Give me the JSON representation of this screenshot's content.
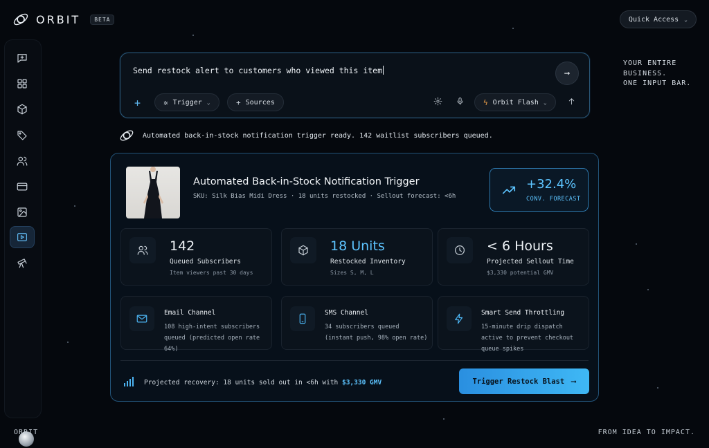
{
  "brand": {
    "name": "ORBIT",
    "badge": "BETA"
  },
  "header": {
    "quick_access": "Quick Access"
  },
  "sidebar": {
    "items": [
      {
        "icon": "chat-plus-icon"
      },
      {
        "icon": "grid-icon"
      },
      {
        "icon": "cube-icon"
      },
      {
        "icon": "tag-icon"
      },
      {
        "icon": "users-icon"
      },
      {
        "icon": "card-icon"
      },
      {
        "icon": "image-icon"
      },
      {
        "icon": "play-icon",
        "active": true
      },
      {
        "icon": "telescope-icon"
      }
    ]
  },
  "input_bar": {
    "prompt": "Send restock alert to customers who viewed this item",
    "trigger_label": "Trigger",
    "sources_label": "Sources",
    "model_label": "Orbit Flash"
  },
  "tagline": [
    "YOUR ENTIRE",
    "BUSINESS.",
    "ONE INPUT BAR."
  ],
  "status": {
    "message": "Automated back-in-stock notification trigger ready. 142 waitlist subscribers queued."
  },
  "card": {
    "title": "Automated Back-in-Stock Notification Trigger",
    "subtitle": "SKU: Silk Bias Midi Dress · 18 units restocked · Sellout forecast: <6h",
    "conversion": {
      "value": "+32.4%",
      "label": "CONV. FORECAST"
    },
    "stats": [
      {
        "value": "142",
        "label": "Queued Subscribers",
        "detail": "Item viewers past 30 days",
        "icon": "users-icon"
      },
      {
        "value": "18 Units",
        "label": "Restocked Inventory",
        "detail": "Sizes S, M, L",
        "icon": "cube-icon"
      },
      {
        "value": "< 6 Hours",
        "label": "Projected Sellout Time",
        "detail": "$3,330 potential GMV",
        "icon": "clock-icon"
      }
    ],
    "channels": [
      {
        "title": "Email Channel",
        "desc": "108 high-intent subscribers queued (predicted open rate 64%)",
        "icon": "mail-icon"
      },
      {
        "title": "SMS Channel",
        "desc": "34 subscribers queued (instant push, 98% open rate)",
        "icon": "phone-icon"
      },
      {
        "title": "Smart Send Throttling",
        "desc": "15-minute drip dispatch active to prevent checkout queue spikes",
        "icon": "bolt-icon"
      }
    ],
    "projection": {
      "text": "Projected recovery: 18 units sold out in <6h with ",
      "gmv": "$3,330 GMV"
    },
    "cta": "Trigger Restock Blast"
  },
  "footer": {
    "left": "ORBIT",
    "right": "FROM IDEA TO IMPACT."
  },
  "colors": {
    "accent": "#5dc4ff",
    "background": "#05080d",
    "button": "#3fb8f5"
  }
}
